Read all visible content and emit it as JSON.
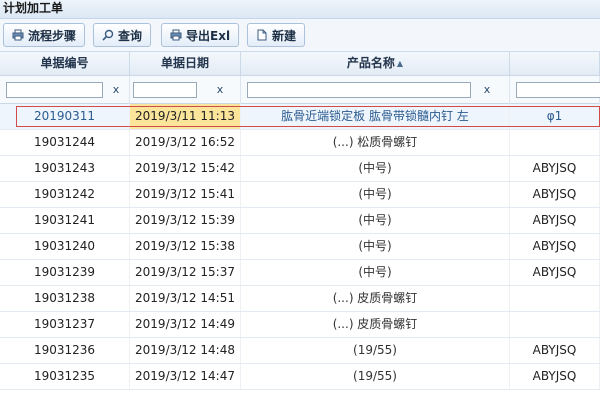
{
  "window": {
    "title": "计划加工单"
  },
  "toolbar": {
    "buttons": [
      {
        "label": "流程步骤",
        "icon": "printer-icon"
      },
      {
        "label": "查询",
        "icon": "search-icon"
      },
      {
        "label": "导出Exl",
        "icon": "printer-icon"
      },
      {
        "label": "新建",
        "icon": "document-icon"
      }
    ]
  },
  "table": {
    "columns": [
      "单据编号",
      "单据日期",
      "产品名称",
      ""
    ],
    "filter_clear": "x",
    "filter_values": [
      "",
      "",
      "",
      ""
    ],
    "rows": [
      {
        "id": "20190311",
        "date": "2019/3/11 11:13",
        "product": "肱骨近端锁定板 肱骨带锁髓内钉 左",
        "code": "φ1"
      },
      {
        "id": "19031244",
        "date": "2019/3/12 16:52",
        "product": "(...) 松质骨螺钉",
        "code": ""
      },
      {
        "id": "19031243",
        "date": "2019/3/12 15:42",
        "product": "(中号)",
        "code": "ABYJSQ"
      },
      {
        "id": "19031242",
        "date": "2019/3/12 15:41",
        "product": "(中号)",
        "code": "ABYJSQ"
      },
      {
        "id": "19031241",
        "date": "2019/3/12 15:39",
        "product": "(中号)",
        "code": "ABYJSQ"
      },
      {
        "id": "19031240",
        "date": "2019/3/12 15:38",
        "product": "(中号)",
        "code": "ABYJSQ"
      },
      {
        "id": "19031239",
        "date": "2019/3/12 15:37",
        "product": "(中号)",
        "code": "ABYJSQ"
      },
      {
        "id": "19031238",
        "date": "2019/3/12 14:51",
        "product": "(...) 皮质骨螺钉",
        "code": ""
      },
      {
        "id": "19031237",
        "date": "2019/3/12 14:49",
        "product": "(...) 皮质骨螺钉",
        "code": ""
      },
      {
        "id": "19031236",
        "date": "2019/3/12 14:48",
        "product": "(19/55)",
        "code": "ABYJSQ"
      },
      {
        "id": "19031235",
        "date": "2019/3/12 14:47",
        "product": "(19/55)",
        "code": "ABYJSQ"
      }
    ],
    "selected_row": 0
  },
  "colors": {
    "selection_outline": "#d24b4b",
    "date_highlight": "#fbe59a",
    "accent": "#2c5b8f"
  }
}
